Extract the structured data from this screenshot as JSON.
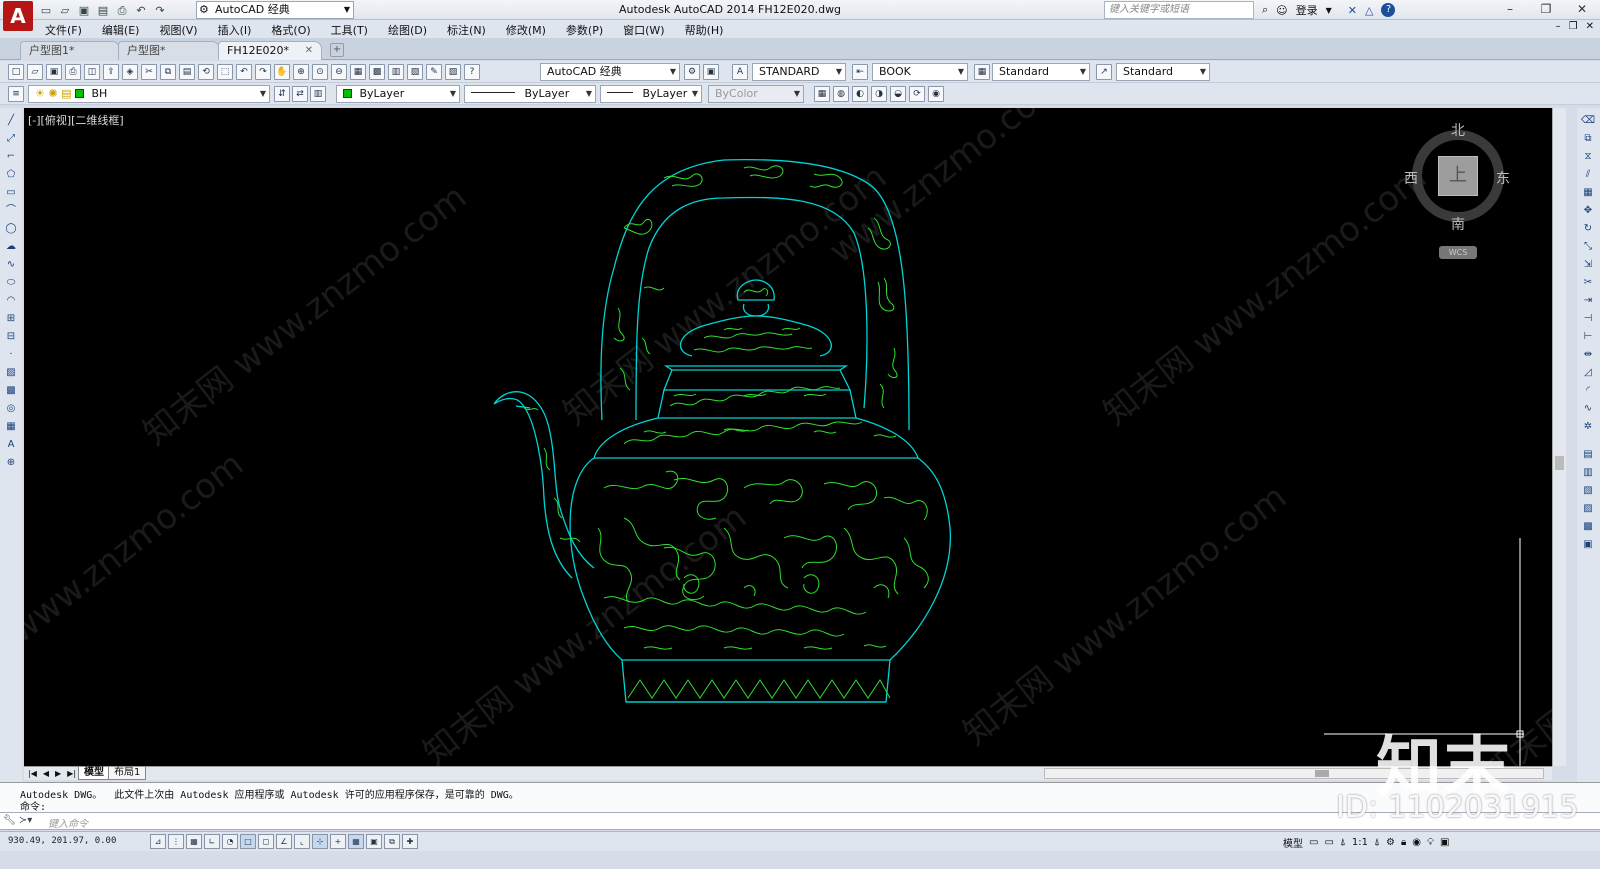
{
  "app": {
    "logo": "A",
    "title": "Autodesk AutoCAD 2014    FH12E020.dwg",
    "workspace": "AutoCAD 经典",
    "search_placeholder": "键入关键字或短语",
    "login": "登录",
    "help": "?"
  },
  "menu": [
    "文件(F)",
    "编辑(E)",
    "视图(V)",
    "插入(I)",
    "格式(O)",
    "工具(T)",
    "绘图(D)",
    "标注(N)",
    "修改(M)",
    "参数(P)",
    "窗口(W)",
    "帮助(H)"
  ],
  "doc_tabs": [
    {
      "label": "户型图1*",
      "active": false
    },
    {
      "label": "户型图*",
      "active": false
    },
    {
      "label": "FH12E020*",
      "active": true
    }
  ],
  "toolbar1": {
    "workspace_combo": "AutoCAD 经典",
    "text_style": "STANDARD",
    "dim_style": "BOOK",
    "table_style": "Standard",
    "mleader_style": "Standard"
  },
  "toolbar2": {
    "layer": "BH",
    "color": "ByLayer",
    "linetype": "ByLayer",
    "lineweight": "ByLayer",
    "plotstyle": "ByColor"
  },
  "viewport": {
    "label": "[-][俯视][二维线框]",
    "accent_line": "#00d4d4",
    "accent_pattern": "#2fe02f"
  },
  "viewcube": {
    "north": "北",
    "south": "南",
    "east": "东",
    "west": "西",
    "face": "上",
    "wcs": "WCS"
  },
  "watermarks": [
    "知末网 www.znzmo.com",
    "知末网 www.znzmo.com",
    "知末网 www.znzmo.com",
    "知末网 www.znzmo.com",
    "知末网 www.znzmo.com",
    "知末网 www.znzmo.com",
    "www.znzmo.com",
    "www.znzmo.com"
  ],
  "layout_tabs": [
    {
      "label": "模型",
      "active": true
    },
    {
      "label": "布局1",
      "active": false
    }
  ],
  "command": {
    "history_line1": "Autodesk DWG。  此文件上次由 Autodesk 应用程序或 Autodesk 许可的应用程序保存，是可靠的 DWG。",
    "history_line2": "命令:",
    "placeholder": "键入命令"
  },
  "status": {
    "coords": "930.49, 201.97, 0.00",
    "model": "模型",
    "scale": "1:1"
  },
  "branding": {
    "logo_text": "知末",
    "id_text": "ID: 1102031915"
  }
}
